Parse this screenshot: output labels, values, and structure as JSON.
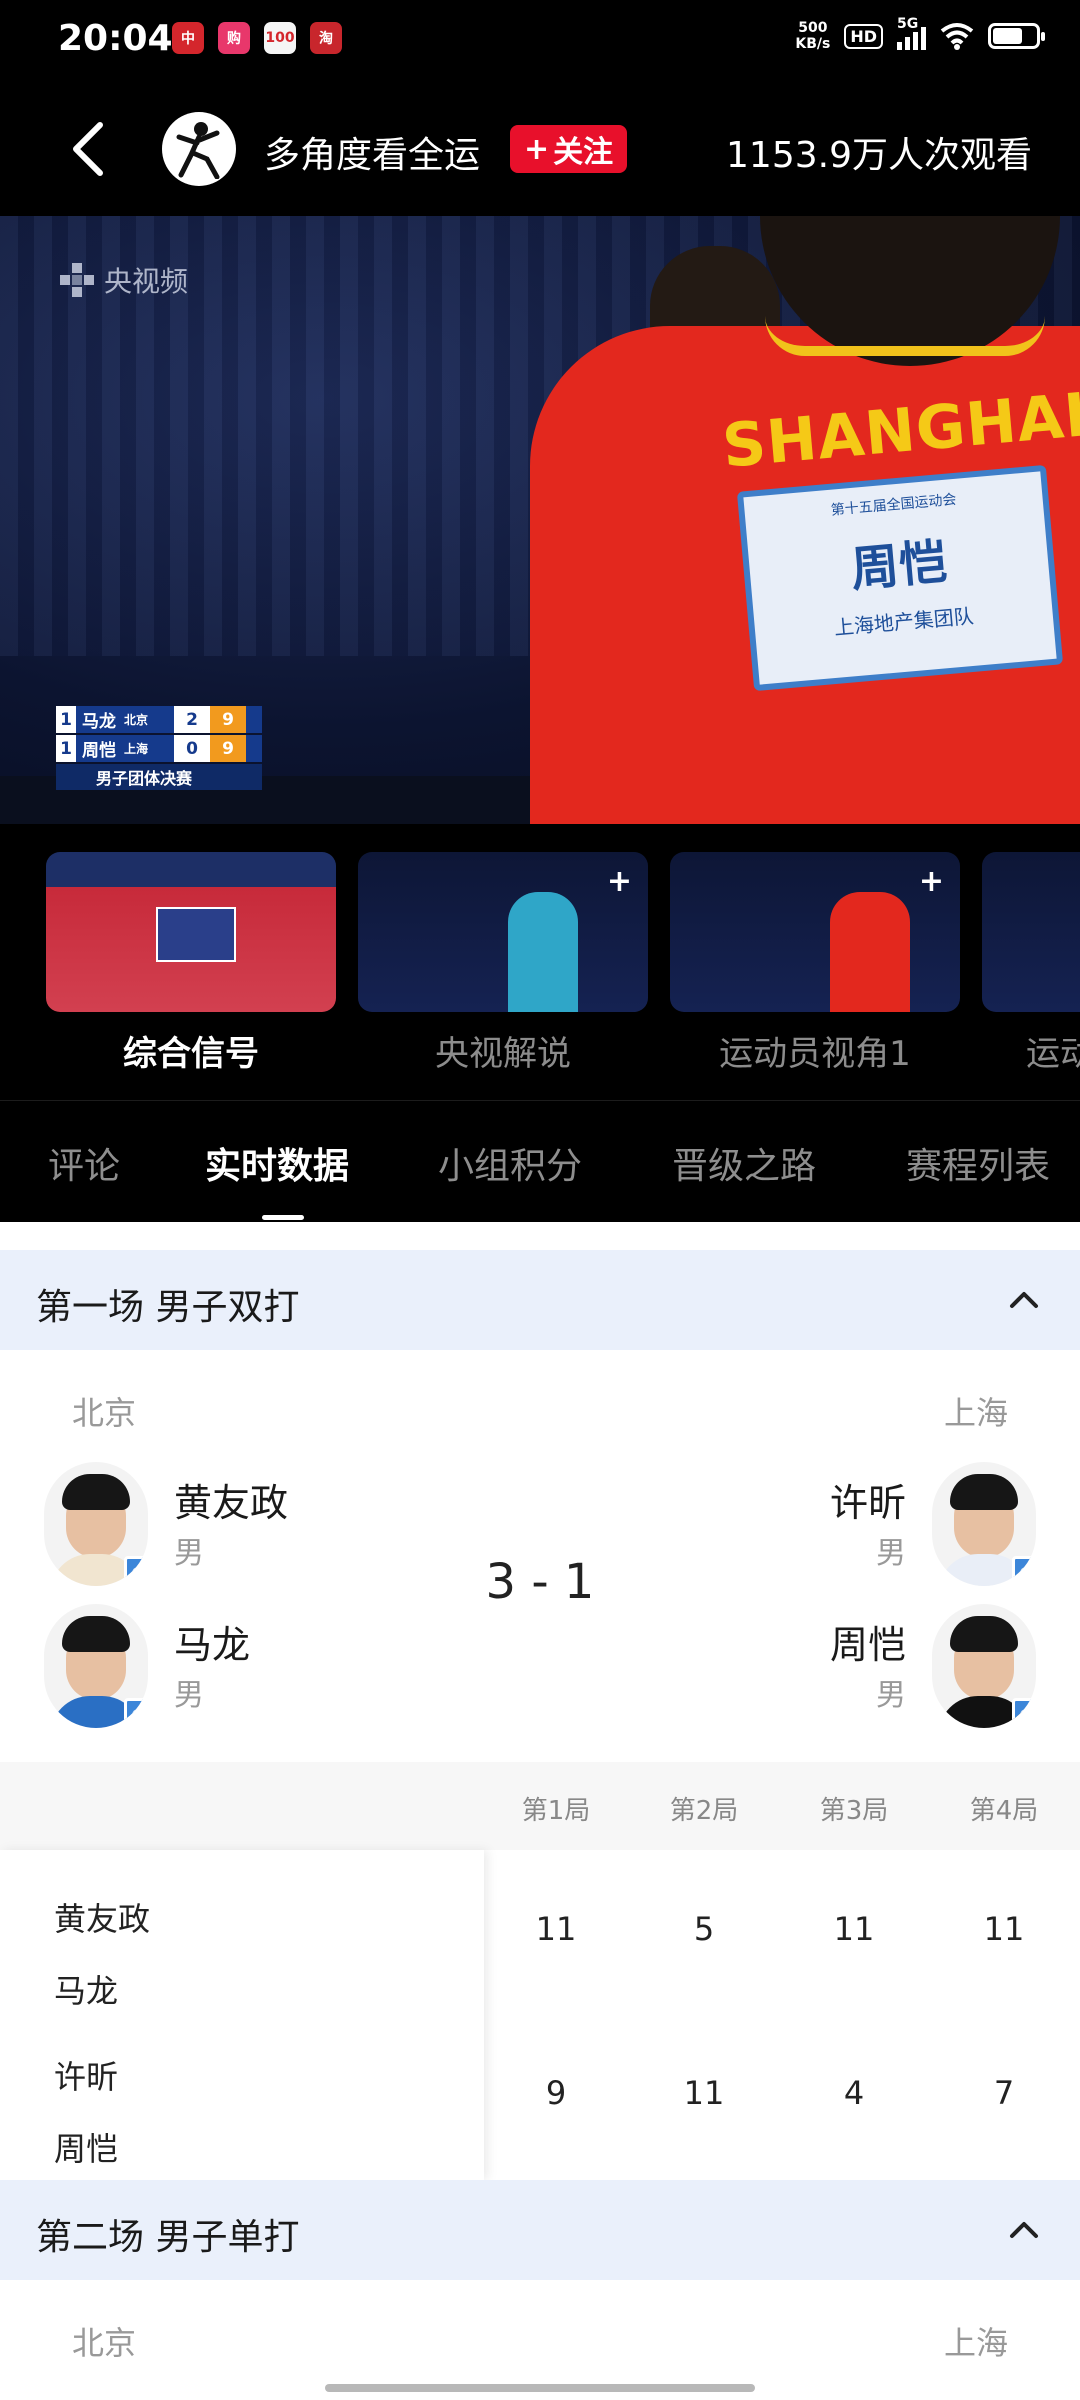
{
  "status_bar": {
    "time": "20:04",
    "apps": [
      {
        "name": "app-1",
        "color": "#d4262c",
        "text": "中"
      },
      {
        "name": "app-2",
        "color": "#e8376b",
        "text": "购"
      },
      {
        "name": "app-3",
        "color": "#f5f5f5",
        "text": "100"
      },
      {
        "name": "app-4",
        "color": "#c8262c",
        "text": "淘"
      }
    ],
    "net_speed": "500",
    "net_unit": "KB/s",
    "hd": "HD",
    "network": "5G"
  },
  "header": {
    "channel_name": "多角度看全运",
    "follow_label": "关注",
    "view_count": "1153.9万人次观看"
  },
  "video": {
    "watermark": "央视频",
    "shirt_text": "SHANGHAI",
    "bib_name": "周恺",
    "bib_top": "第十五届全国运动会",
    "bib_bottom": "上海地产集团队",
    "scoreboard": {
      "rows": [
        {
          "rank": "1",
          "name": "马龙",
          "team": "北京",
          "games": "2",
          "points": "9"
        },
        {
          "rank": "1",
          "name": "周恺",
          "team": "上海",
          "games": "0",
          "points": "9"
        }
      ],
      "event": "男子团体决赛"
    }
  },
  "cameras": [
    {
      "label": "综合信号",
      "active": true
    },
    {
      "label": "央视解说",
      "active": false
    },
    {
      "label": "运动员视角1",
      "active": false
    },
    {
      "label": "运动",
      "active": false
    }
  ],
  "tabs": [
    "评论",
    "实时数据",
    "小组积分",
    "晋级之路",
    "赛程列表"
  ],
  "active_tab": "实时数据",
  "matches": [
    {
      "title": "第一场 男子双打",
      "left_team": "北京",
      "right_team": "上海",
      "left_players": [
        {
          "name": "黄友政",
          "gender": "男"
        },
        {
          "name": "马龙",
          "gender": "男"
        }
      ],
      "right_players": [
        {
          "name": "许昕",
          "gender": "男"
        },
        {
          "name": "周恺",
          "gender": "男"
        }
      ],
      "score": "3 - 1",
      "set_headers": [
        "第1局",
        "第2局",
        "第3局",
        "第4局"
      ],
      "left_pair": [
        "黄友政",
        "马龙"
      ],
      "right_pair": [
        "许昕",
        "周恺"
      ],
      "left_sets": [
        "11",
        "5",
        "11",
        "11"
      ],
      "right_sets": [
        "9",
        "11",
        "4",
        "7"
      ]
    },
    {
      "title": "第二场 男子单打",
      "left_team": "北京",
      "right_team": "上海"
    }
  ],
  "gender_symbol": "♂"
}
